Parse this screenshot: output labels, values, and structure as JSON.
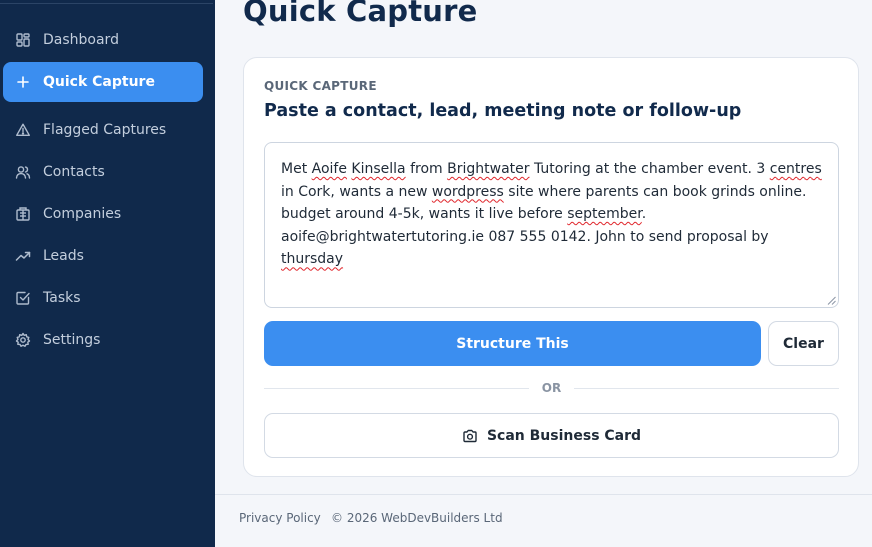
{
  "sidebar": {
    "items": [
      {
        "label": "Dashboard",
        "icon": "dashboard-icon",
        "active": false
      },
      {
        "label": "Quick Capture",
        "icon": "plus-icon",
        "active": true
      },
      {
        "label": "Flagged Captures",
        "icon": "warning-triangle-icon",
        "active": false
      },
      {
        "label": "Contacts",
        "icon": "users-icon",
        "active": false
      },
      {
        "label": "Companies",
        "icon": "building-icon",
        "active": false
      },
      {
        "label": "Leads",
        "icon": "trending-up-icon",
        "active": false
      },
      {
        "label": "Tasks",
        "icon": "checkbox-icon",
        "active": false
      },
      {
        "label": "Settings",
        "icon": "gear-icon",
        "active": false
      }
    ]
  },
  "main": {
    "page_title": "Quick Capture",
    "card": {
      "eyebrow": "QUICK CAPTURE",
      "heading": "Paste a contact, lead, meeting note or follow-up",
      "note_text": "Met Aoife Kinsella from Brightwater Tutoring at the chamber event. 3 centres in Cork, wants a new wordpress site where parents can book grinds online. budget around 4-5k, wants it live before september. aoife@brightwatertutoring.ie 087 555 0142. John to send proposal by thursday",
      "primary_button": "Structure This",
      "clear_button": "Clear",
      "divider_text": "OR",
      "scan_button": "Scan Business Card",
      "scan_icon": "camera-icon"
    }
  },
  "footer": {
    "privacy": "Privacy Policy",
    "copyright": "© 2026 WebDevBuilders Ltd"
  },
  "colors": {
    "sidebar_bg": "#10294b",
    "accent": "#3b8ef0",
    "title": "#112a4c",
    "page_bg": "#f4f6fa"
  }
}
